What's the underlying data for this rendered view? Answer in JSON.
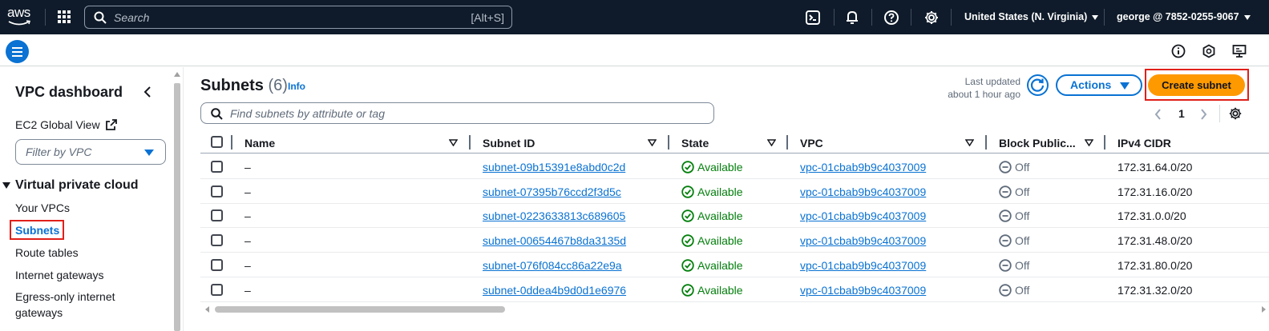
{
  "topnav": {
    "logo_text": "aws",
    "search_placeholder": "Search",
    "search_shortcut": "[Alt+S]",
    "region": "United States (N. Virginia)",
    "account": "george @ 7852-0255-9067",
    "icons": [
      "cloudshell-icon",
      "bell-icon",
      "help-icon",
      "settings-icon"
    ]
  },
  "bar2": {
    "icons": [
      "info-icon",
      "feedback-icon",
      "display-settings-icon"
    ]
  },
  "sidebar": {
    "title": "VPC dashboard",
    "ec2_global_view": "EC2 Global View",
    "filter_placeholder": "Filter by VPC",
    "section": "Virtual private cloud",
    "items": [
      {
        "label": "Your VPCs",
        "active": false
      },
      {
        "label": "Subnets",
        "active": true
      },
      {
        "label": "Route tables",
        "active": false
      },
      {
        "label": "Internet gateways",
        "active": false
      },
      {
        "label": "Egress-only internet",
        "active": false
      },
      {
        "label": "gateways",
        "active": false
      }
    ]
  },
  "header": {
    "title": "Subnets",
    "count": "(6)",
    "info": "Info",
    "last_updated_line1": "Last updated",
    "last_updated_line2": "about 1 hour ago",
    "actions_label": "Actions",
    "create_label": "Create subnet",
    "find_placeholder": "Find subnets by attribute or tag",
    "page_number": "1"
  },
  "table": {
    "columns": [
      "Name",
      "Subnet ID",
      "State",
      "VPC",
      "Block Public...",
      "IPv4 CIDR"
    ],
    "rows": [
      {
        "name": "–",
        "subnet_id": "subnet-09b15391e8abd0c2d",
        "state": "Available",
        "vpc": "vpc-01cbab9b9c4037009",
        "block": "Off",
        "cidr": "172.31.64.0/20"
      },
      {
        "name": "–",
        "subnet_id": "subnet-07395b76ccd2f3d5c",
        "state": "Available",
        "vpc": "vpc-01cbab9b9c4037009",
        "block": "Off",
        "cidr": "172.31.16.0/20"
      },
      {
        "name": "–",
        "subnet_id": "subnet-0223633813c689605",
        "state": "Available",
        "vpc": "vpc-01cbab9b9c4037009",
        "block": "Off",
        "cidr": "172.31.0.0/20"
      },
      {
        "name": "–",
        "subnet_id": "subnet-00654467b8da3135d",
        "state": "Available",
        "vpc": "vpc-01cbab9b9c4037009",
        "block": "Off",
        "cidr": "172.31.48.0/20"
      },
      {
        "name": "–",
        "subnet_id": "subnet-076f084cc86a22e9a",
        "state": "Available",
        "vpc": "vpc-01cbab9b9c4037009",
        "block": "Off",
        "cidr": "172.31.80.0/20"
      },
      {
        "name": "–",
        "subnet_id": "subnet-0ddea4b9d0d1e6976",
        "state": "Available",
        "vpc": "vpc-01cbab9b9c4037009",
        "block": "Off",
        "cidr": "172.31.32.0/20"
      }
    ]
  },
  "colors": {
    "nav_bg": "#0f1b2a",
    "link": "#0972d3",
    "primary_button": "#ff9900",
    "available": "#037f0c",
    "highlight": "#e0201a"
  }
}
